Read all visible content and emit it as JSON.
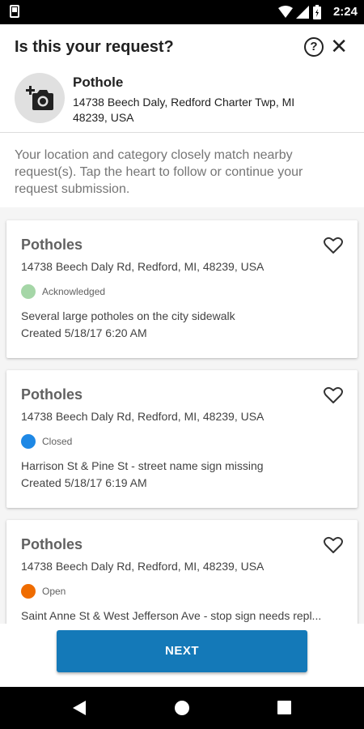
{
  "status_bar": {
    "time": "2:24"
  },
  "header": {
    "title": "Is this your request?",
    "help_icon": "help-circle-icon",
    "close_icon": "close-icon"
  },
  "request": {
    "category": "Pothole",
    "address": "14738 Beech Daly, Redford Charter Twp, MI 48239, USA",
    "photo_icon": "add-photo-camera-icon"
  },
  "note": "Your location and category closely match nearby request(s). Tap the heart to follow or continue your request submission.",
  "requests": [
    {
      "title": "Potholes",
      "address": "14738 Beech Daly Rd, Redford, MI, 48239, USA",
      "status": "Acknowledged",
      "status_color": "#a5d6a7",
      "description": "Several large potholes on the city sidewalk",
      "created": "Created 5/18/17 6:20 AM"
    },
    {
      "title": "Potholes",
      "address": "14738 Beech Daly Rd, Redford, MI, 48239, USA",
      "status": "Closed",
      "status_color": "#1e88e5",
      "description": "Harrison St & Pine St - street name sign missing",
      "created": "Created 5/18/17 6:19 AM"
    },
    {
      "title": "Potholes",
      "address": "14738 Beech Daly Rd, Redford, MI, 48239, USA",
      "status": "Open",
      "status_color": "#ef6c00",
      "description": "Saint Anne St & West Jefferson Ave - stop sign needs repl...",
      "created": ""
    }
  ],
  "next_label": "NEXT",
  "colors": {
    "primary": "#1479b8"
  }
}
